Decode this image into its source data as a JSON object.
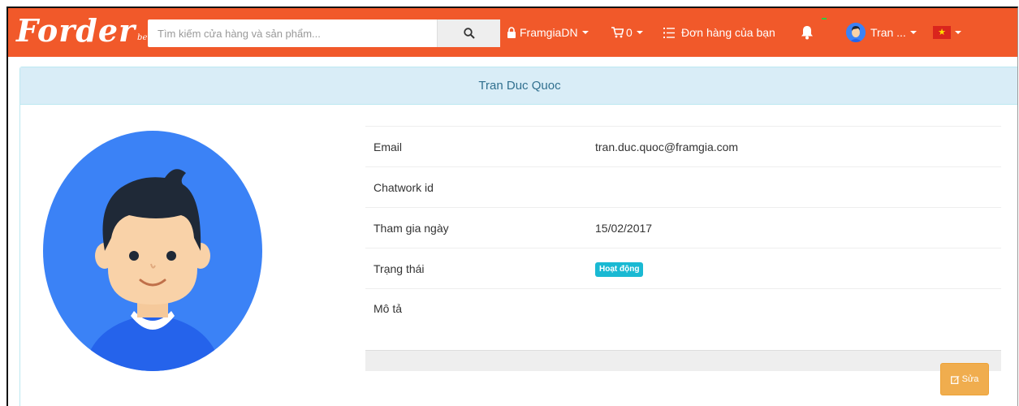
{
  "navbar": {
    "logo": {
      "text": "Forder",
      "beta": "beta"
    },
    "search": {
      "placeholder": "Tìm kiếm cửa hàng và sản phẩm...",
      "icon": "search-icon"
    },
    "shop_menu": {
      "label": "FramgiaDN",
      "icon": "lock-icon"
    },
    "cart": {
      "count": "0",
      "icon": "cart-icon"
    },
    "orders": {
      "label": "Đơn hàng của bạn",
      "icon": "list-icon"
    },
    "notifications": {
      "icon": "bell-icon"
    },
    "user_menu": {
      "label": "Tran ...",
      "icon": "avatar"
    },
    "language": {
      "icon": "vietnam-flag-icon"
    }
  },
  "profile": {
    "name": "Tran Duc Quoc",
    "fields": [
      {
        "label": "Email",
        "value": "tran.duc.quoc@framgia.com"
      },
      {
        "label": "Chatwork id",
        "value": ""
      },
      {
        "label": "Tham gia ngày",
        "value": "15/02/2017"
      },
      {
        "label": "Trạng thái",
        "value": "Hoạt động"
      },
      {
        "label": "Mô tả",
        "value": ""
      }
    ],
    "edit_label": "Sửa"
  },
  "colors": {
    "navbar": "#f1592a",
    "panel_heading": "#d9edf7",
    "status_badge": "#1ab9d3",
    "edit_button": "#f0ad4e",
    "avatar_bg": "#3b82f6"
  }
}
